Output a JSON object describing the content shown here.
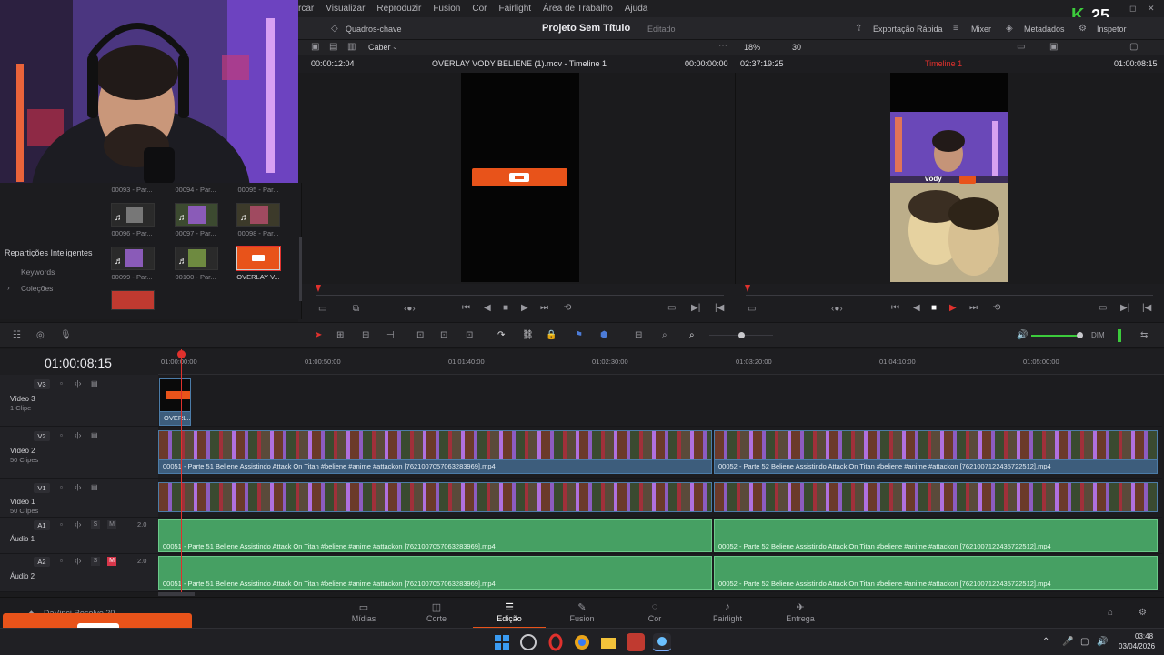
{
  "menu": [
    "rcar",
    "Visualizar",
    "Reproduzir",
    "Fusion",
    "Cor",
    "Fairlight",
    "Área de Trabalho",
    "Ajuda"
  ],
  "toolbar": {
    "keyframes_label": "Quadros-chave",
    "project_title": "Projeto Sem Título",
    "project_status": "Editado",
    "quick_export": "Exportação Rápida",
    "mixer": "Mixer",
    "metadata": "Metadados",
    "inspector": "Inspetor"
  },
  "viewer_bar": {
    "fit": "Caber",
    "zoom": "18%",
    "fps": "30"
  },
  "source_viewer": {
    "timecode_left": "00:00:12:04",
    "clip_name": "OVERLAY VODY BELIENE (1).mov - Timeline 1",
    "timecode_right": "00:00:00:00"
  },
  "timeline_viewer": {
    "duration": "02:37:19:25",
    "timeline_name": "Timeline 1",
    "timecode": "01:00:08:15",
    "brand_overlay": "vody"
  },
  "streamer_badge": {
    "letter": "K",
    "count": "25"
  },
  "media_pool": {
    "row0_captions": [
      "00093 - Par...",
      "00094 - Par...",
      "00095 - Par..."
    ],
    "row1_captions": [
      "00096 - Par...",
      "00097 - Par...",
      "00098 - Par..."
    ],
    "row2_captions": [
      "00099 - Par...",
      "00100 - Par...",
      "OVERLAY V..."
    ],
    "smart_bins": "Repartições Inteligentes",
    "keywords": "Keywords",
    "collections": "Coleções"
  },
  "timeline": {
    "current_timecode": "01:00:08:15",
    "ruler_labels": [
      "01:00:00:00",
      "01:00:50:00",
      "01:01:40:00",
      "01:02:30:00",
      "01:03:20:00",
      "01:04:10:00",
      "01:05:00:00"
    ],
    "tracks": {
      "v3": {
        "id": "V3",
        "name": "Vídeo 3",
        "sub": "1 Clipe"
      },
      "v2": {
        "id": "V2",
        "name": "Vídeo 2",
        "sub": "50 Clipes"
      },
      "v1": {
        "id": "V1",
        "name": "Vídeo 1",
        "sub": "50 Clipes"
      },
      "a1": {
        "id": "A1",
        "name": "Áudio 1",
        "level": "2.0"
      },
      "a2": {
        "id": "A2",
        "name": "Áudio 2",
        "level": "2.0"
      }
    },
    "overlay_clip_label": "OVERL...",
    "clip_51": "00051 - Parte 51 Beliene Assistindo Attack On Titan #beliene #anime #attackon [7621007057063283969].mp4",
    "clip_52": "00052 - Parte 52 Beliene Assistindo Attack On Titan #beliene #anime #attackon [7621007122435722512].mp4",
    "dim_label": "DIM"
  },
  "pages": [
    "Mídias",
    "Corte",
    "Edição",
    "Fusion",
    "Cor",
    "Fairlight",
    "Entrega"
  ],
  "app_name": "DaVinci Resolve 20",
  "taskbar": {
    "time": "03:48",
    "date": "03/04/2026"
  },
  "colors": {
    "accent": "#e8531a",
    "playhead": "#e0312d",
    "audio": "#46a063",
    "video_bar": "#3d5d7c"
  }
}
